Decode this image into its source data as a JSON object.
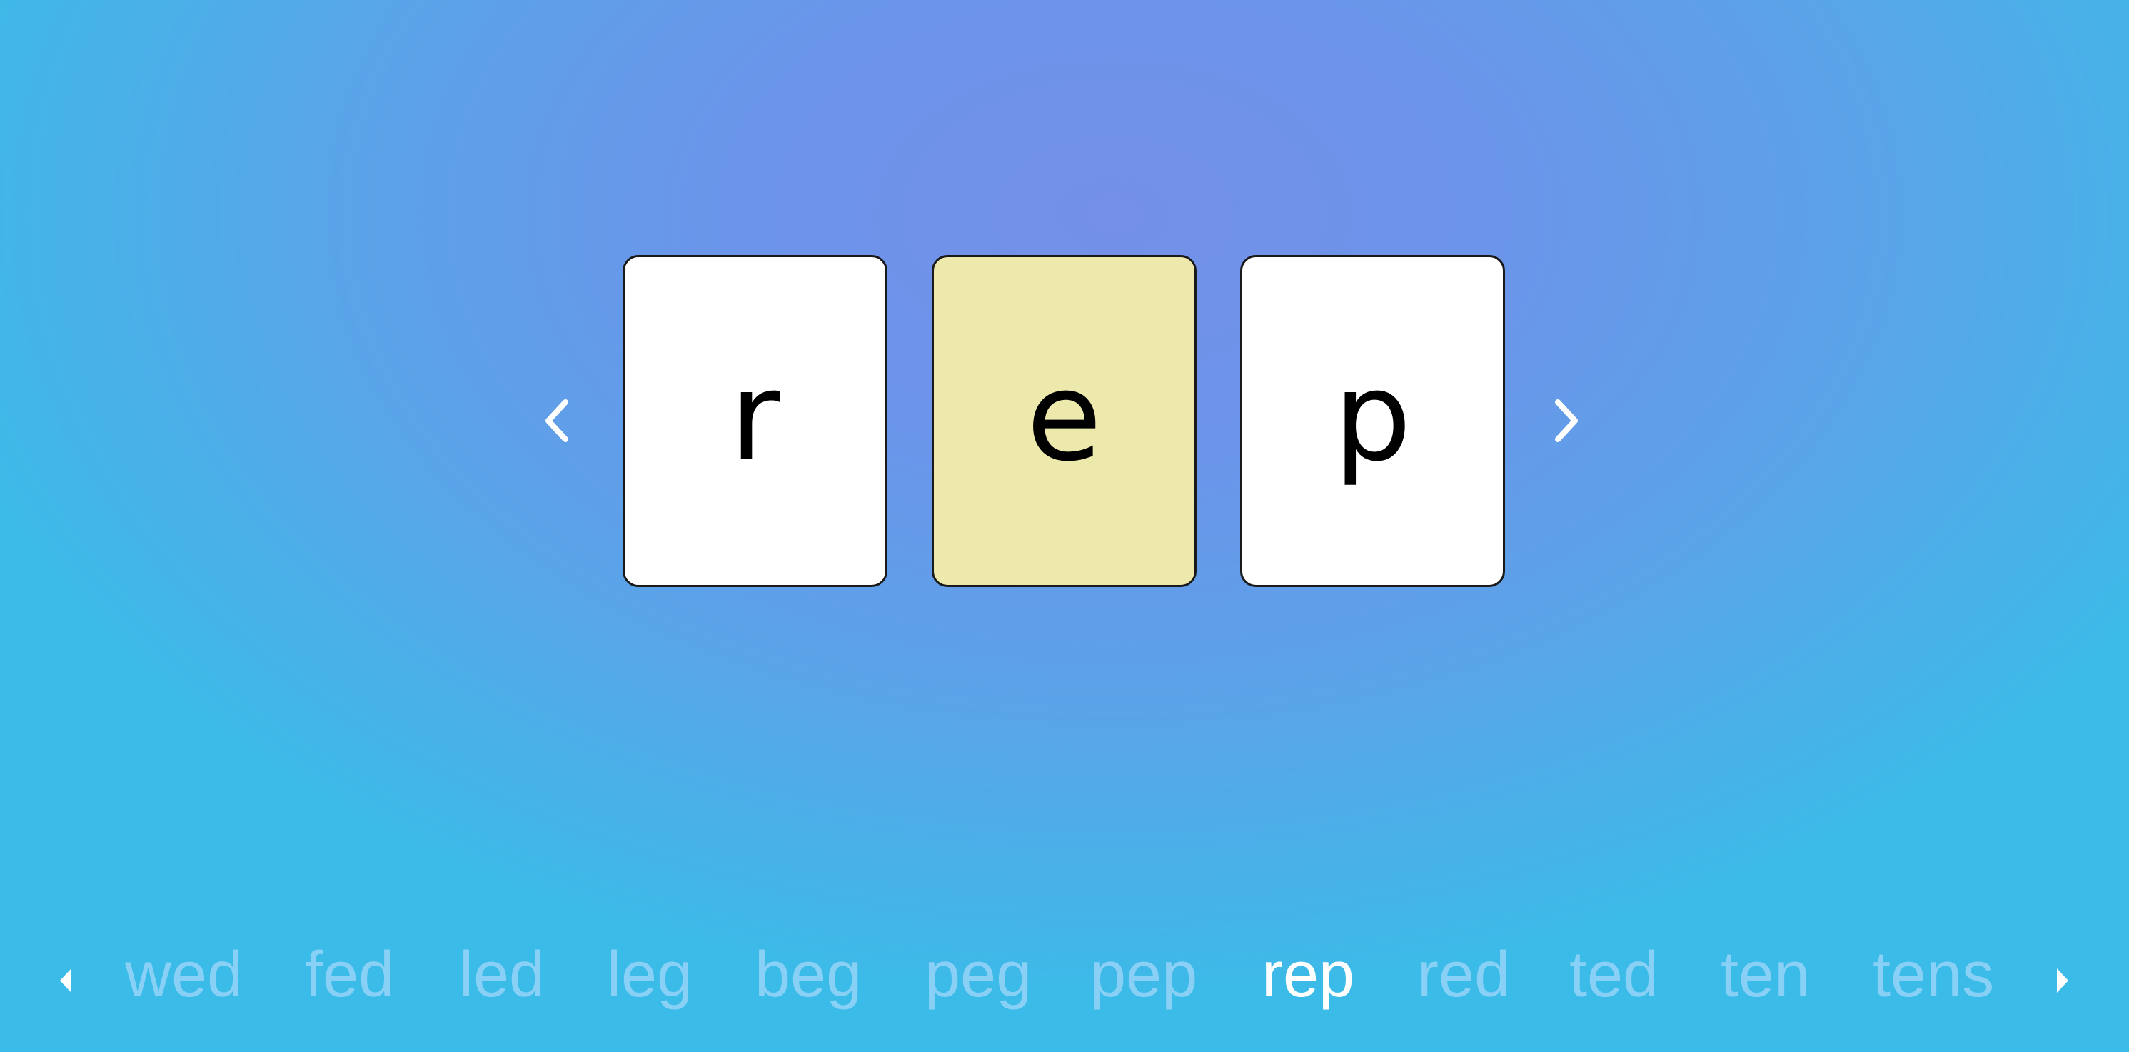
{
  "game": {
    "current_word": "rep",
    "letters": [
      {
        "char": "r",
        "highlighted": false
      },
      {
        "char": "e",
        "highlighted": true
      },
      {
        "char": "p",
        "highlighted": false
      }
    ],
    "prev_icon": "chevron-left-icon",
    "next_icon": "chevron-right-icon"
  },
  "word_strip": {
    "prev_icon": "triangle-left-icon",
    "next_icon": "triangle-right-icon",
    "active_index": 7,
    "words": [
      "wed",
      "fed",
      "led",
      "leg",
      "beg",
      "peg",
      "pep",
      "rep",
      "red",
      "ted",
      "ten",
      "tens"
    ]
  },
  "colors": {
    "card_default": "#FFFFFF",
    "card_highlight": "#EDE8AC",
    "card_border": "#1A1A1A",
    "background_center": "#7490E8",
    "background_edge": "#3BBBE8",
    "word_active": "#FFFFFF",
    "word_inactive": "#A7CCF4"
  }
}
